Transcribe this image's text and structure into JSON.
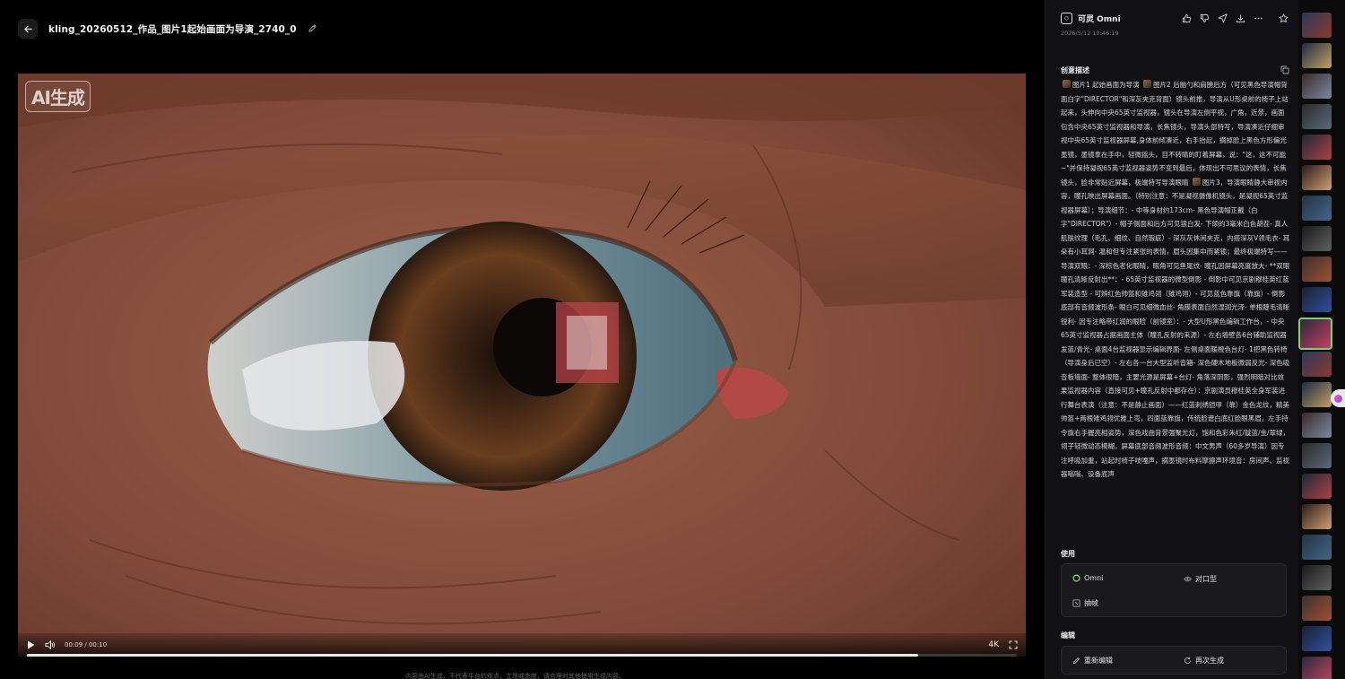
{
  "header": {
    "title": "kling_20260512_作品_图片1起始画面为导演_2740_0"
  },
  "video": {
    "ai_badge": "AI生成",
    "time": "00:09 / 00:10",
    "quality": "4K",
    "progress": 0.9,
    "disclaimer": "内容由AI生成，不代表平台的观点，立场或态度，请合理对其他使用生成内容。"
  },
  "panel": {
    "brand": "可灵 Omni",
    "date": "2026/5/12 10:46:19",
    "desc_title": "创意描述",
    "desc_parts": [
      "图片1",
      "起始画面为导演",
      "图片2",
      "后脑勺和肩膀后方（可见黑色导演帽背面白字\"DIRECTOR\"和深灰夹克背面）镜头前推，导演从U形桌前的椅子上站起来，头伸向中央65英寸监视器，镜头在导演左侧平视，广角，近景，画面包含中央65英寸监视器和导演，长焦镜头，导演头部特写，导演凑近仔细审视中央65英寸监视器屏幕,身体前倾凑近，右手抬起，摘掉脸上黑色方形偏光墨镜，墨镜拿在手中，轻微摇头，目不转睛的盯着屏幕，说：\"这，这不可能~\"并保持凝视65英寸监视器姿势不变到最后，体现出不可思议的表情，长焦镜头，脸非常贴近屏幕，极端特写导演眼睛",
      "图片3",
      "，导演眼睛静大审视内容，瞳孔映出屏幕画面。（特别注意：不是凝视摄像机镜头，是凝视65英寸监视器屏幕）；导演细节：- 中等身材约173cm- 黑色导演帽正戴（白字\"DIRECTOR\"）- 帽子侧面和后方可见银白发- 下颌的3毫米白色胡茬- 真人肌肤纹理（毛孔、细纹、自然瑕疵）- 深灰灰休闲夹克，内搭深灰V领毛衣- 耳朵有小耳洞- 温和但专注紧张的表情，眉头因集中而紧锁；最终极端特写——导演双眼：- 深棕色老化眼睛，眼角可见鱼尾纹- 瞳孔因屏幕亮度放大- **双眼瞳孔清晰反射出**：- 65英寸监视器的微型倒影 - 倒影中可见京剧穆桂英红蓝军装造型 - 可辨红色帅盔和雉鸡翎（雉鸡翎）- 可见蓝色靠旗（靠旗）- 倒影底部有音频波形条- 眼白可见细微血丝- 角膜表面自然湿润光泽- 单根睫毛清晰锐利- 因专注略带红润的眼睑（前镜室）：- 大型U形黑色编辑工作台，- 中央65英寸监视器占据画面主体（瞳孔反射的来源）- 左右墙壁各6台辅助监视器发蓝/青光- 桌面4台监视器显示编辑界面- 左侧桌面暖橙色台灯- 1把黑色转椅（导演身后已空）- 左右各一台大型监听音箱- 深色硬木地板微弱反光- 深色吸音板墙面- 整体很暗，主要光源是屏幕+台灯- 角落深阴影，强烈明暗对比效果监视器内容（直接可见+瞳孔反射中都存在）：京剧演员穆桂英全身军装进行舞台表演（注意：不是静止画面）——红蓝刺绣铠甲（靠）金色龙纹，精美帅盔+两根雉鸡翎优雅上弯，四面蓝靠旗，传统脸谱白底红脸眼黑眉，左手持令旗右手握亮相姿势，深色戏曲背景强聚光灯，饱和色彩朱红/靛蓝/金/翠绿，翎子轻微动态模糊，屏幕底部音频波形音频：中文男声（60多岁导演）因专注呼吸加重，站起时椅子吱嘎声，摘墨镜时布料摩擦声环境音：房间声、监视器嗡嗡、设备底声"
    ],
    "use_title": "使用",
    "use_items": [
      "Omni",
      "对口型",
      "抽帧"
    ],
    "edit_title": "编辑",
    "edit_items": [
      "重新编辑",
      "再次生成"
    ]
  },
  "icons": {
    "back": "arrow-left-icon",
    "edit": "pencil-icon",
    "like": "thumbs-up-icon",
    "dislike": "thumbs-down-icon",
    "share": "send-icon",
    "download": "download-icon",
    "more": "more-icon",
    "star": "star-icon",
    "copy": "copy-icon"
  },
  "colors": {
    "accent": "#7bd56b",
    "panel_bg": "#111113"
  }
}
